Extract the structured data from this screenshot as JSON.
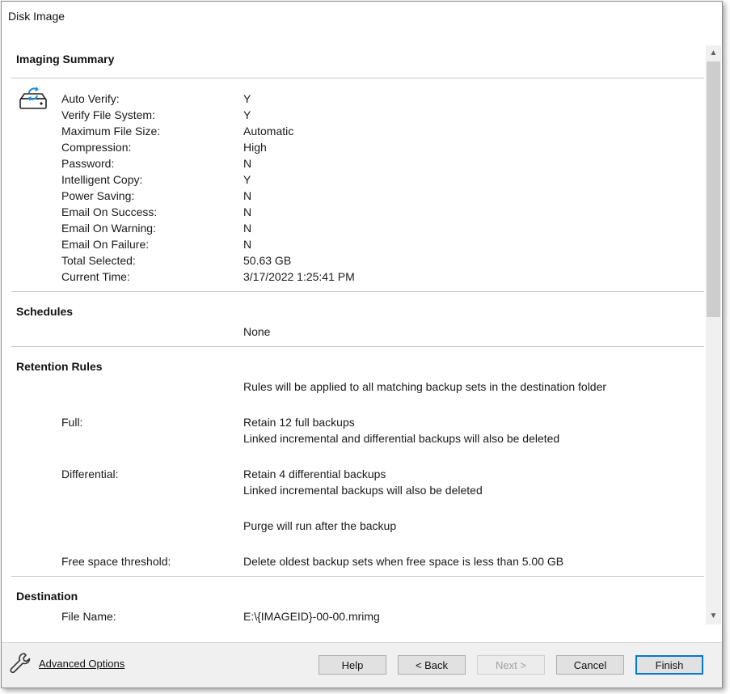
{
  "window": {
    "title": "Disk Image"
  },
  "summary": {
    "heading": "Imaging Summary",
    "icon": "disk-refresh-icon",
    "rows": [
      {
        "label": "Auto Verify:",
        "value": "Y"
      },
      {
        "label": "Verify File System:",
        "value": "Y"
      },
      {
        "label": "Maximum File Size:",
        "value": "Automatic"
      },
      {
        "label": "Compression:",
        "value": "High"
      },
      {
        "label": "Password:",
        "value": "N"
      },
      {
        "label": "Intelligent Copy:",
        "value": "Y"
      },
      {
        "label": "Power Saving:",
        "value": "N"
      },
      {
        "label": "Email On Success:",
        "value": "N"
      },
      {
        "label": "Email On Warning:",
        "value": "N"
      },
      {
        "label": "Email On Failure:",
        "value": "N"
      },
      {
        "label": "Total Selected:",
        "value": "50.63 GB"
      },
      {
        "label": "Current Time:",
        "value": "3/17/2022 1:25:41 PM"
      }
    ]
  },
  "schedules": {
    "heading": "Schedules",
    "value": "None"
  },
  "retention": {
    "heading": "Retention Rules",
    "intro": "Rules will be applied to all matching backup sets in the destination folder",
    "full_label": "Full:",
    "full_line1": "Retain 12 full backups",
    "full_line2": "Linked incremental and differential backups will also be deleted",
    "diff_label": "Differential:",
    "diff_line1": "Retain 4 differential backups",
    "diff_line2": "Linked incremental backups will also be deleted",
    "purge": "Purge will run after the backup",
    "free_label": "Free space threshold:",
    "free_value": "Delete oldest backup sets when free space is less than 5.00 GB"
  },
  "destination": {
    "heading": "Destination",
    "file_label": "File Name:",
    "file_value": "E:\\{IMAGEID}-00-00.mrimg"
  },
  "footer": {
    "advanced_label": "Advanced Options",
    "help_label": "Help",
    "back_label": "< Back",
    "next_label": "Next >",
    "cancel_label": "Cancel",
    "finish_label": "Finish"
  },
  "colors": {
    "accent": "#0078d7",
    "icon_blue": "#1e88e5"
  }
}
